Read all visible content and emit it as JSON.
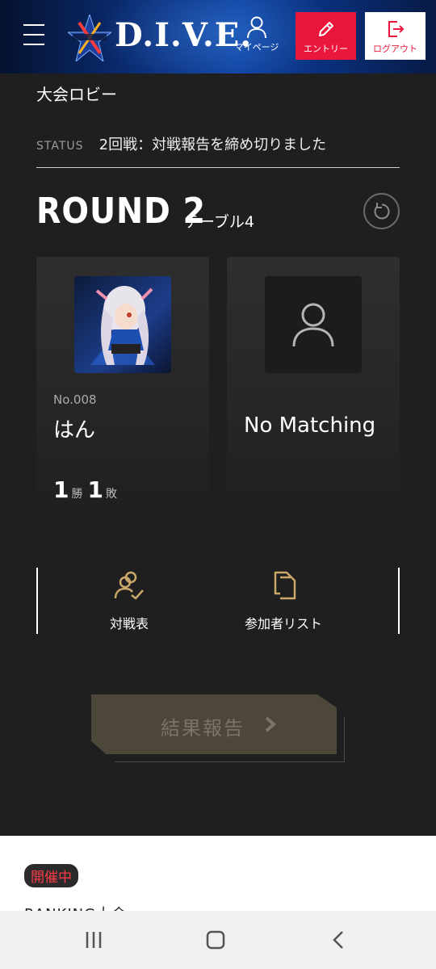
{
  "header": {
    "logo_text": "D.I.V.E.",
    "mypage_label": "マイページ",
    "entry_label": "エントリー",
    "logout_label": "ログアウト"
  },
  "lobby": {
    "title": "大会ロビー",
    "status_key": "STATUS",
    "status_value": "2回戦：対戦報告を締め切りました"
  },
  "round": {
    "title": "ROUND 2",
    "table": "テーブル4"
  },
  "players": [
    {
      "number": "No.008",
      "name": "はん",
      "wins": "1",
      "win_unit": "勝",
      "losses": "1",
      "loss_unit": "敗"
    },
    {
      "name": "No Matching"
    }
  ],
  "links": {
    "bracket_label": "対戦表",
    "participants_label": "参加者リスト"
  },
  "report_button": {
    "label": "結果報告"
  },
  "lower": {
    "badge": "開催中",
    "ranking_text": "RANKING大会"
  },
  "colors": {
    "accent_red": "#e8173b",
    "gold": "#c9a86a",
    "report_bg": "#4d473a"
  }
}
